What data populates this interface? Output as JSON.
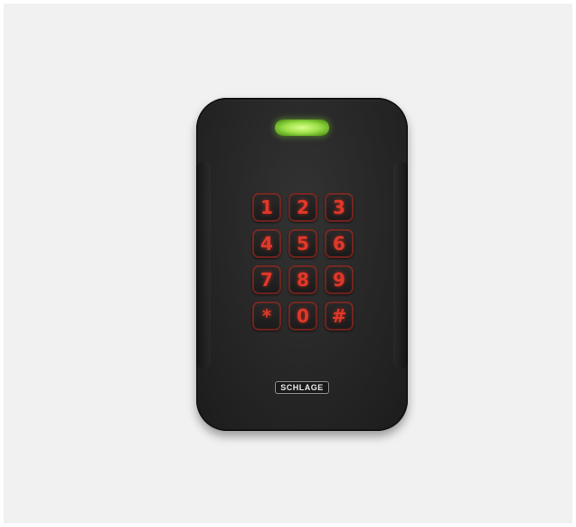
{
  "device": {
    "brand": "SCHLAGE",
    "led_color": "#8fd83c",
    "key_color": "#e3382a",
    "keys": [
      "1",
      "2",
      "3",
      "4",
      "5",
      "6",
      "7",
      "8",
      "9",
      "*",
      "0",
      "#"
    ]
  }
}
